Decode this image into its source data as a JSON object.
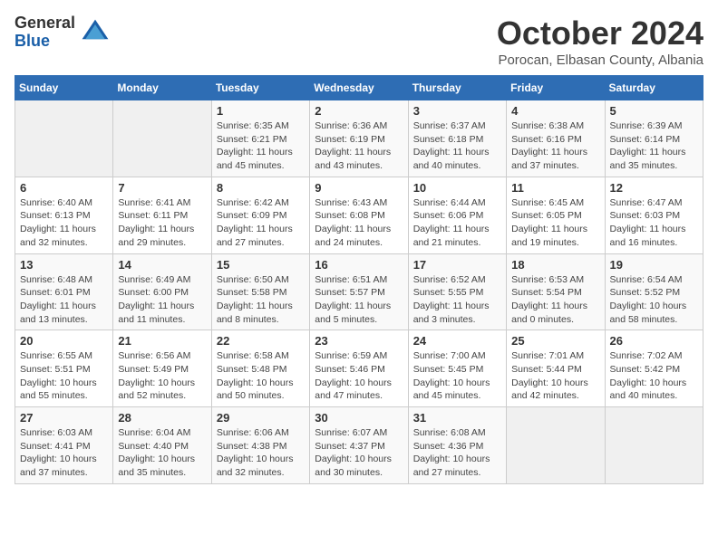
{
  "logo": {
    "general": "General",
    "blue": "Blue"
  },
  "title": "October 2024",
  "location": "Porocan, Elbasan County, Albania",
  "weekdays": [
    "Sunday",
    "Monday",
    "Tuesday",
    "Wednesday",
    "Thursday",
    "Friday",
    "Saturday"
  ],
  "weeks": [
    [
      {
        "day": "",
        "info": ""
      },
      {
        "day": "",
        "info": ""
      },
      {
        "day": "1",
        "info": "Sunrise: 6:35 AM\nSunset: 6:21 PM\nDaylight: 11 hours and 45 minutes."
      },
      {
        "day": "2",
        "info": "Sunrise: 6:36 AM\nSunset: 6:19 PM\nDaylight: 11 hours and 43 minutes."
      },
      {
        "day": "3",
        "info": "Sunrise: 6:37 AM\nSunset: 6:18 PM\nDaylight: 11 hours and 40 minutes."
      },
      {
        "day": "4",
        "info": "Sunrise: 6:38 AM\nSunset: 6:16 PM\nDaylight: 11 hours and 37 minutes."
      },
      {
        "day": "5",
        "info": "Sunrise: 6:39 AM\nSunset: 6:14 PM\nDaylight: 11 hours and 35 minutes."
      }
    ],
    [
      {
        "day": "6",
        "info": "Sunrise: 6:40 AM\nSunset: 6:13 PM\nDaylight: 11 hours and 32 minutes."
      },
      {
        "day": "7",
        "info": "Sunrise: 6:41 AM\nSunset: 6:11 PM\nDaylight: 11 hours and 29 minutes."
      },
      {
        "day": "8",
        "info": "Sunrise: 6:42 AM\nSunset: 6:09 PM\nDaylight: 11 hours and 27 minutes."
      },
      {
        "day": "9",
        "info": "Sunrise: 6:43 AM\nSunset: 6:08 PM\nDaylight: 11 hours and 24 minutes."
      },
      {
        "day": "10",
        "info": "Sunrise: 6:44 AM\nSunset: 6:06 PM\nDaylight: 11 hours and 21 minutes."
      },
      {
        "day": "11",
        "info": "Sunrise: 6:45 AM\nSunset: 6:05 PM\nDaylight: 11 hours and 19 minutes."
      },
      {
        "day": "12",
        "info": "Sunrise: 6:47 AM\nSunset: 6:03 PM\nDaylight: 11 hours and 16 minutes."
      }
    ],
    [
      {
        "day": "13",
        "info": "Sunrise: 6:48 AM\nSunset: 6:01 PM\nDaylight: 11 hours and 13 minutes."
      },
      {
        "day": "14",
        "info": "Sunrise: 6:49 AM\nSunset: 6:00 PM\nDaylight: 11 hours and 11 minutes."
      },
      {
        "day": "15",
        "info": "Sunrise: 6:50 AM\nSunset: 5:58 PM\nDaylight: 11 hours and 8 minutes."
      },
      {
        "day": "16",
        "info": "Sunrise: 6:51 AM\nSunset: 5:57 PM\nDaylight: 11 hours and 5 minutes."
      },
      {
        "day": "17",
        "info": "Sunrise: 6:52 AM\nSunset: 5:55 PM\nDaylight: 11 hours and 3 minutes."
      },
      {
        "day": "18",
        "info": "Sunrise: 6:53 AM\nSunset: 5:54 PM\nDaylight: 11 hours and 0 minutes."
      },
      {
        "day": "19",
        "info": "Sunrise: 6:54 AM\nSunset: 5:52 PM\nDaylight: 10 hours and 58 minutes."
      }
    ],
    [
      {
        "day": "20",
        "info": "Sunrise: 6:55 AM\nSunset: 5:51 PM\nDaylight: 10 hours and 55 minutes."
      },
      {
        "day": "21",
        "info": "Sunrise: 6:56 AM\nSunset: 5:49 PM\nDaylight: 10 hours and 52 minutes."
      },
      {
        "day": "22",
        "info": "Sunrise: 6:58 AM\nSunset: 5:48 PM\nDaylight: 10 hours and 50 minutes."
      },
      {
        "day": "23",
        "info": "Sunrise: 6:59 AM\nSunset: 5:46 PM\nDaylight: 10 hours and 47 minutes."
      },
      {
        "day": "24",
        "info": "Sunrise: 7:00 AM\nSunset: 5:45 PM\nDaylight: 10 hours and 45 minutes."
      },
      {
        "day": "25",
        "info": "Sunrise: 7:01 AM\nSunset: 5:44 PM\nDaylight: 10 hours and 42 minutes."
      },
      {
        "day": "26",
        "info": "Sunrise: 7:02 AM\nSunset: 5:42 PM\nDaylight: 10 hours and 40 minutes."
      }
    ],
    [
      {
        "day": "27",
        "info": "Sunrise: 6:03 AM\nSunset: 4:41 PM\nDaylight: 10 hours and 37 minutes."
      },
      {
        "day": "28",
        "info": "Sunrise: 6:04 AM\nSunset: 4:40 PM\nDaylight: 10 hours and 35 minutes."
      },
      {
        "day": "29",
        "info": "Sunrise: 6:06 AM\nSunset: 4:38 PM\nDaylight: 10 hours and 32 minutes."
      },
      {
        "day": "30",
        "info": "Sunrise: 6:07 AM\nSunset: 4:37 PM\nDaylight: 10 hours and 30 minutes."
      },
      {
        "day": "31",
        "info": "Sunrise: 6:08 AM\nSunset: 4:36 PM\nDaylight: 10 hours and 27 minutes."
      },
      {
        "day": "",
        "info": ""
      },
      {
        "day": "",
        "info": ""
      }
    ]
  ]
}
